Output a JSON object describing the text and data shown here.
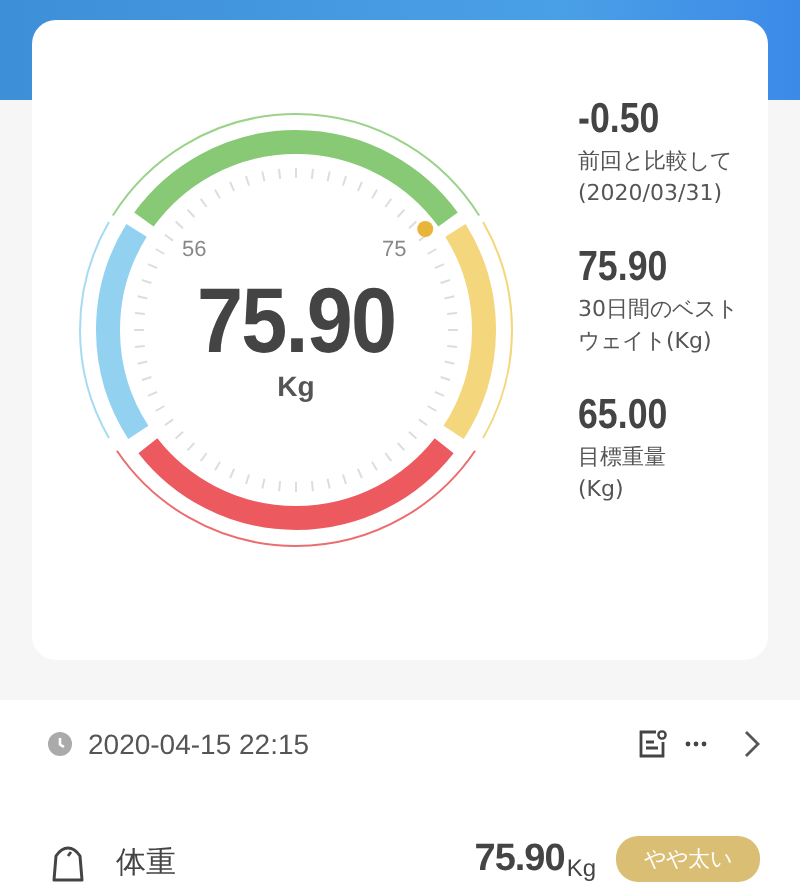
{
  "gauge": {
    "value": "75.90",
    "unit": "Kg",
    "low_label": "56",
    "high_label": "75"
  },
  "stats": [
    {
      "value": "-0.50",
      "label": [
        "前回と比較して",
        "(2020/03/31)"
      ]
    },
    {
      "value": "75.90",
      "label": [
        "30日間のベスト",
        "ウェイト(Kg)"
      ]
    },
    {
      "value": "65.00",
      "label": [
        "目標重量",
        "(Kg)"
      ]
    }
  ],
  "record": {
    "datetime": "2020-04-15 22:15"
  },
  "metric": {
    "name": "体重",
    "value": "75.90",
    "unit": "Kg",
    "badge": "やや太い"
  }
}
